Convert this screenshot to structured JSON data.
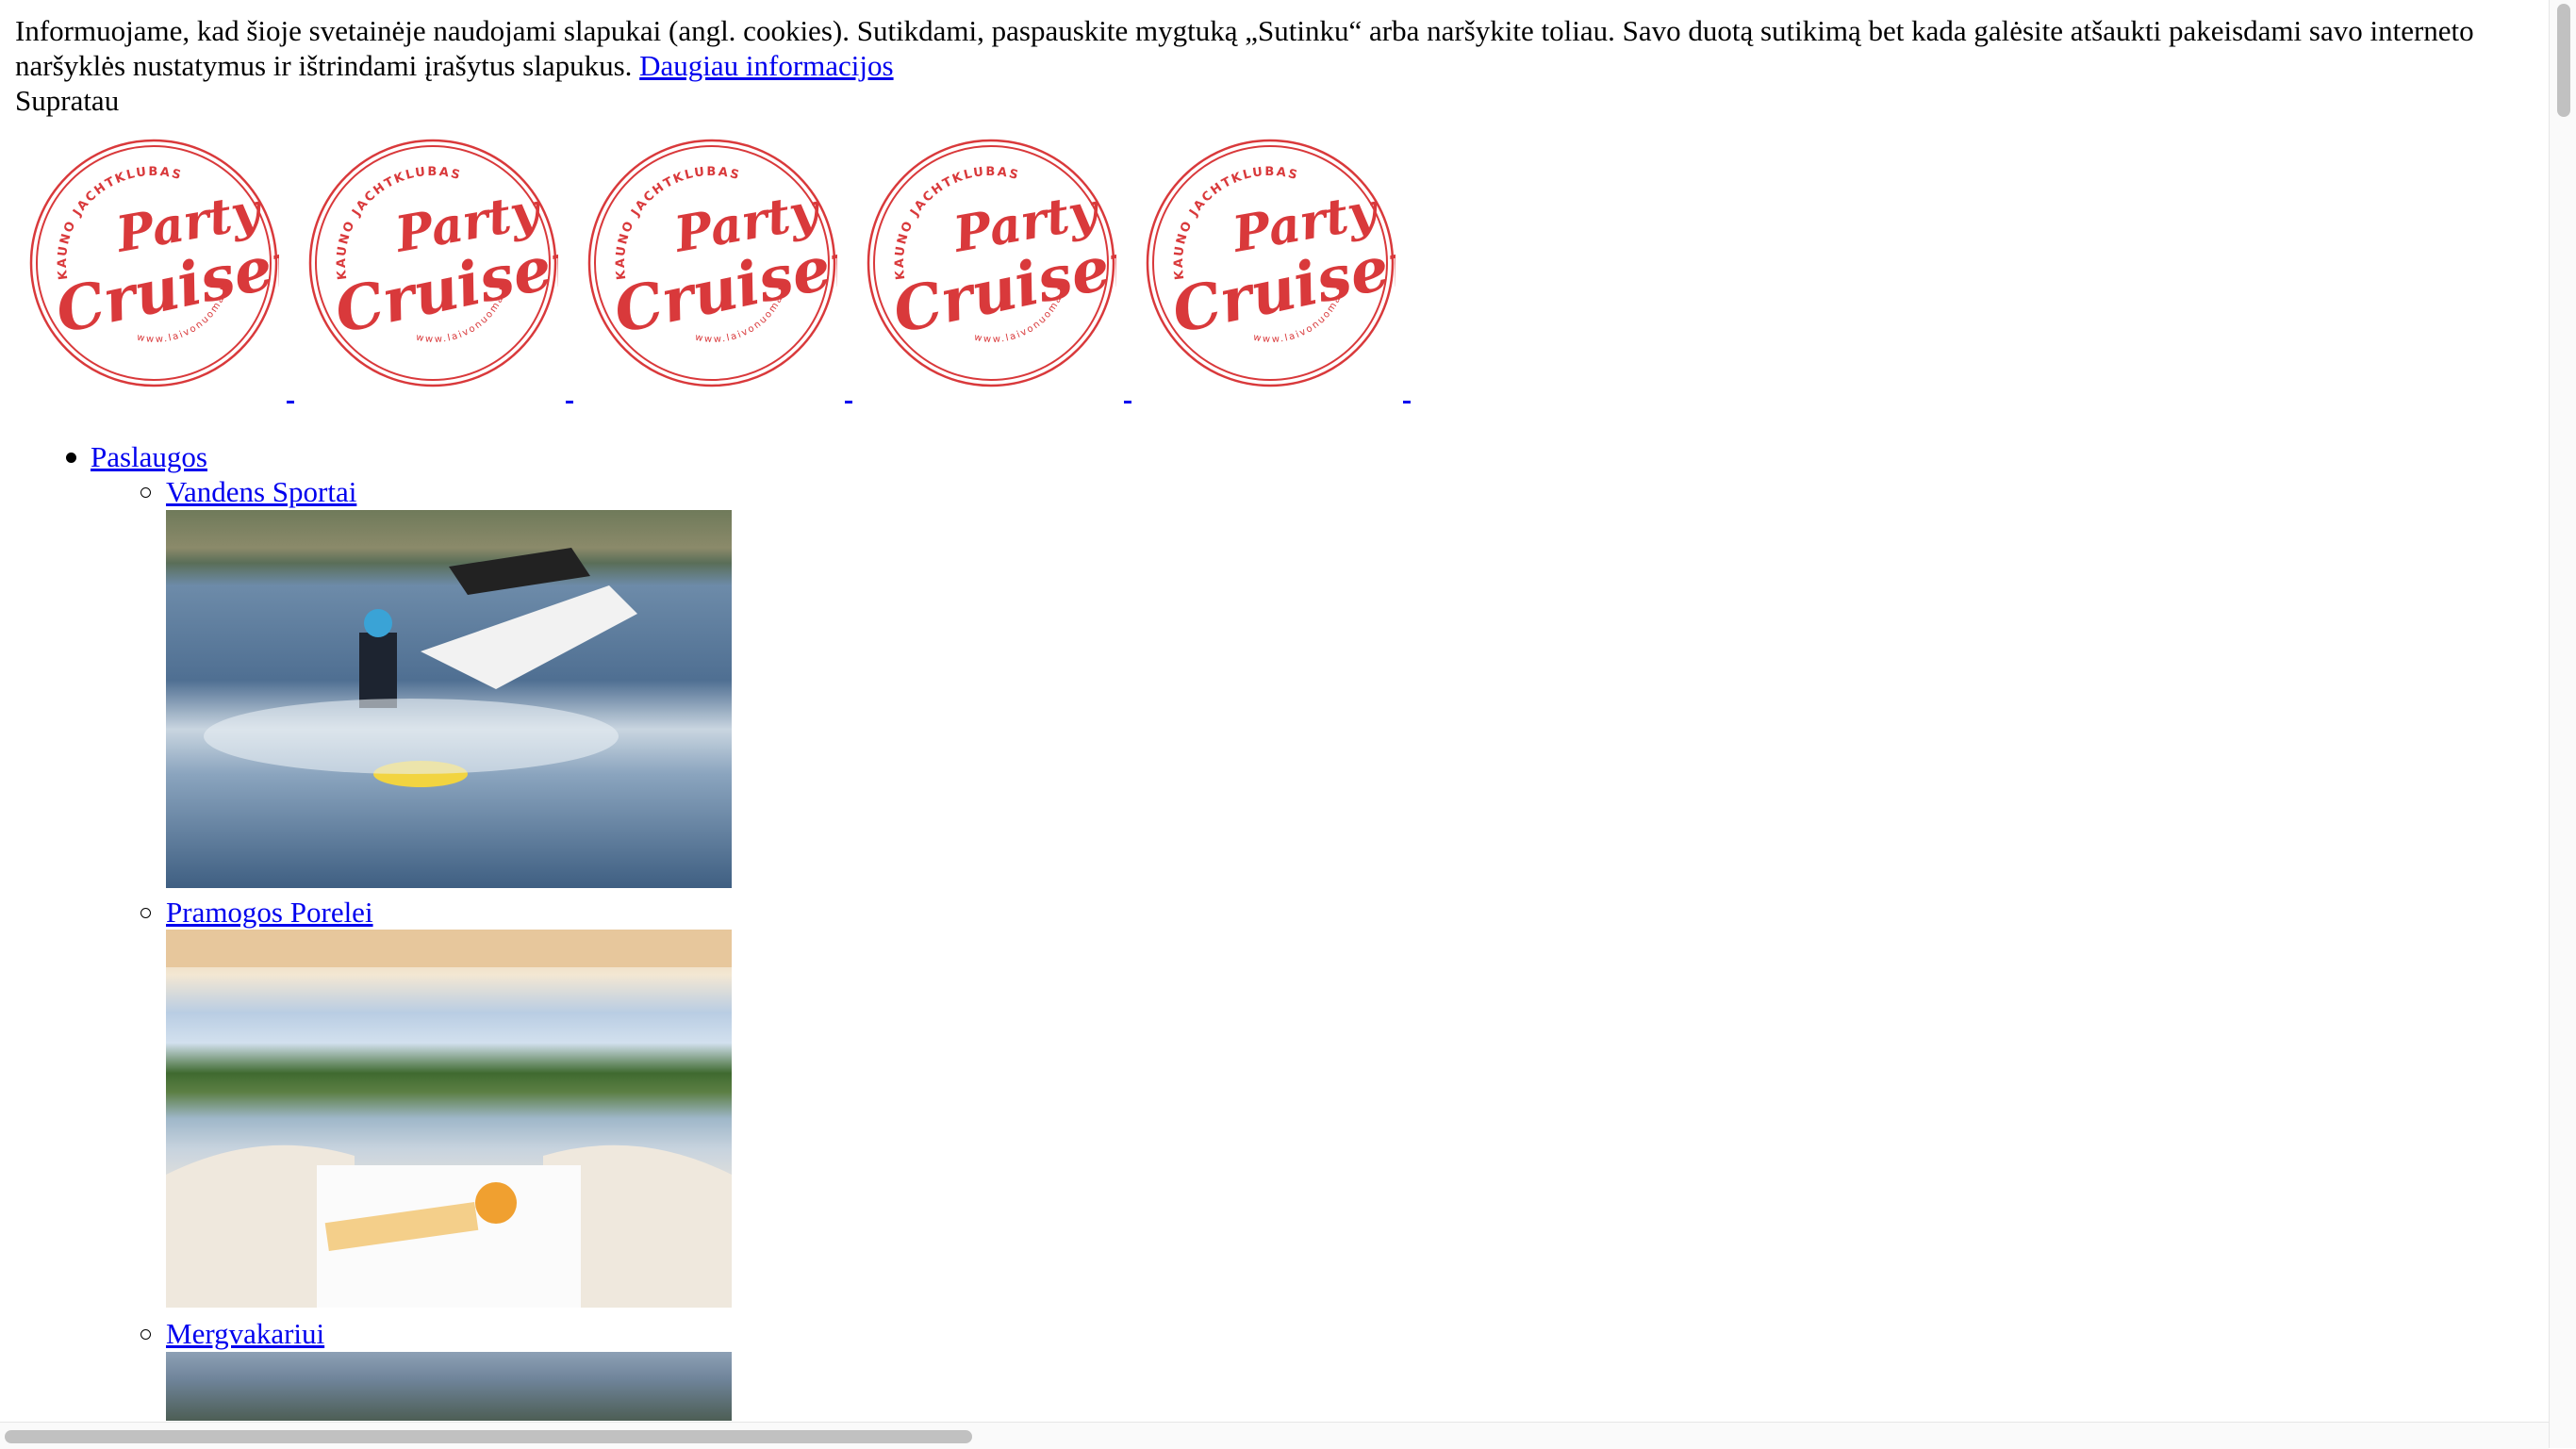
{
  "cookie_notice": {
    "text": "Informuojame, kad šioje svetainėje naudojami slapukai (angl. cookies). Sutikdami, paspauskite mygtuką „Sutinku“ arba naršykite toliau. Savo duotą sutikimą bet kada galėsite atšaukti pakeisdami savo interneto naršyklės nustatymus ir ištrindami įrašytus slapukus. ",
    "more_link": "Daugiau informacijos",
    "accept": "Supratau"
  },
  "logos": [
    {
      "top_text": "KAUNO JACHTKLUBAS",
      "main": "Party Cruiser",
      "bottom_text": "www.laivonuoma.lt"
    },
    {
      "top_text": "KAUNO JACHTKLUBAS",
      "main": "Party Cruiser",
      "bottom_text": "www.laivonuoma.lt"
    },
    {
      "top_text": "KAUNO JACHTKLUBAS",
      "main": "Party Cruiser",
      "bottom_text": "www.laivonuoma.lt"
    },
    {
      "top_text": "KAUNO JACHTKLUBAS",
      "main": "Party Cruiser",
      "bottom_text": "www.laivonuoma.lt"
    },
    {
      "top_text": "KAUNO JACHTKLUBAS",
      "main": "Party Cruiser",
      "bottom_text": "www.laivonuoma.lt"
    }
  ],
  "logo_color": "#d9393b",
  "nav": {
    "top": "Paslaugos",
    "items": [
      {
        "label": "Vandens Sportai"
      },
      {
        "label": "Pramogos Porelei"
      },
      {
        "label": "Mergvakariui"
      }
    ]
  }
}
